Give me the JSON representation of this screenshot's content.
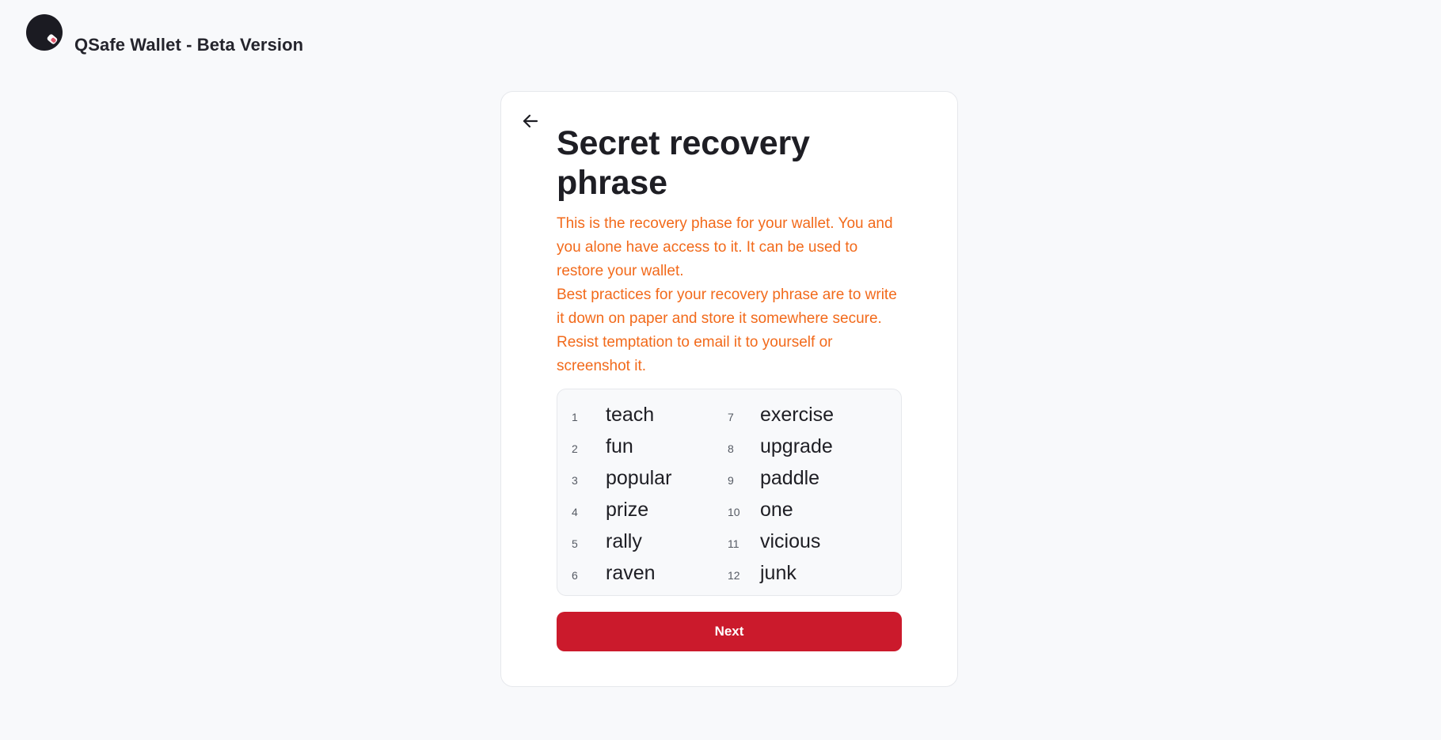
{
  "header": {
    "logo_icon": "wallet-key-icon",
    "title": "QSafe Wallet - Beta Version"
  },
  "card": {
    "back_icon": "arrow-left-icon",
    "heading": "Secret recovery phrase",
    "description": [
      "This is the recovery phase for your wallet. You and you alone have access to it. It can be used to restore your wallet.",
      "Best practices for your recovery phrase are to write it down on paper and store it somewhere secure. Resist temptation to email it to yourself or screenshot it."
    ],
    "phrase": [
      {
        "num": "1",
        "word": "teach"
      },
      {
        "num": "2",
        "word": "fun"
      },
      {
        "num": "3",
        "word": "popular"
      },
      {
        "num": "4",
        "word": "prize"
      },
      {
        "num": "5",
        "word": "rally"
      },
      {
        "num": "6",
        "word": "raven"
      },
      {
        "num": "7",
        "word": "exercise"
      },
      {
        "num": "8",
        "word": "upgrade"
      },
      {
        "num": "9",
        "word": "paddle"
      },
      {
        "num": "10",
        "word": "one"
      },
      {
        "num": "11",
        "word": "vicious"
      },
      {
        "num": "12",
        "word": "junk"
      }
    ],
    "next_label": "Next"
  },
  "colors": {
    "background": "#f8f9fb",
    "accent_button": "#cb1a2c",
    "warning_text": "#f26a1b",
    "heading_text": "#1e1e24"
  }
}
